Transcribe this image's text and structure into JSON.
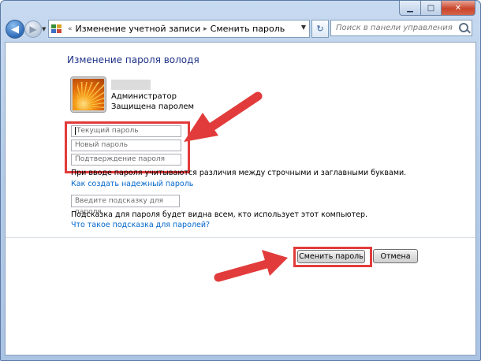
{
  "window": {
    "minimize_glyph": "▁",
    "maximize_glyph": "□",
    "close_glyph": "✕"
  },
  "navigation": {
    "back_glyph": "◀",
    "forward_glyph": "▶",
    "dropdown_glyph": "▼",
    "overflow_chevron": "«",
    "breadcrumb": [
      "Изменение учетной записи",
      "Сменить пароль"
    ],
    "breadcrumb_sep": "▸",
    "refresh_glyph": "↻",
    "search_placeholder": "Поиск в панели управления"
  },
  "page": {
    "heading": "Изменение пароля володя",
    "account": {
      "username": "",
      "role": "Администратор",
      "protection": "Защищена паролем"
    },
    "fields": {
      "current_password_placeholder": "Текущий пароль",
      "new_password_placeholder": "Новый пароль",
      "confirm_password_placeholder": "Подтверждение пароля",
      "hint_placeholder": "Введите подсказку для пароля"
    },
    "case_note": "При вводе пароля учитываются различия между строчными и заглавными буквами.",
    "strong_password_link": "Как создать надежный пароль",
    "hint_note": "Подсказка для пароля будет видна всем, кто использует этот компьютер.",
    "hint_link": "Что такое подсказка для паролей?",
    "buttons": {
      "change": "Сменить пароль",
      "cancel": "Отмена"
    }
  },
  "colors": {
    "heading": "#1e3287",
    "link": "#0066cc",
    "annotation": "#e23b3b"
  },
  "icons": [
    "back-arrow-icon",
    "forward-arrow-icon",
    "control-panel-icon",
    "refresh-icon",
    "search-icon",
    "user-avatar-icon",
    "annotation-arrow"
  ]
}
